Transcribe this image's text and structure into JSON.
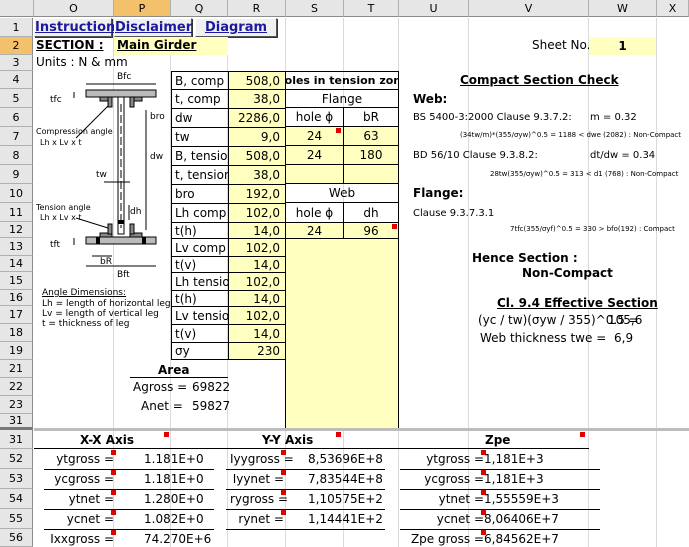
{
  "columns": [
    "O",
    "P",
    "Q",
    "R",
    "S",
    "T",
    "U",
    "V",
    "W",
    "X"
  ],
  "rows": [
    "1",
    "2",
    "3",
    "4",
    "5",
    "6",
    "7",
    "8",
    "9",
    "10",
    "11",
    "12",
    "13",
    "14",
    "15",
    "16",
    "17",
    "18",
    "19",
    "21",
    "22",
    "23",
    "31",
    "52",
    "53",
    "54",
    "55",
    "56"
  ],
  "buttons": {
    "instructions": "Instructions",
    "disclaimer": "Disclaimer",
    "diagram": "Diagram"
  },
  "header": {
    "section_label": "SECTION :",
    "section_value": "Main Girder",
    "units": "Units : N  & mm",
    "sheet_label": "Sheet No.",
    "sheet_value": "1"
  },
  "diagram_labels": {
    "bfc": "Bfc",
    "tfc": "tfc",
    "bro": "bro",
    "dw": "dw",
    "tw": "tw",
    "dh": "dh",
    "tfc2": "tft",
    "bR": "bR",
    "bft": "Bft",
    "comp_angle": "Compression angle",
    "comp_angle_dims": "Lh x Lv x t",
    "tens_angle": "Tension angle",
    "tens_angle_dims": "Lh x Lv x t",
    "angle_title": "Angle Dimensions:",
    "angle_lh": "Lh = length of horizontal leg",
    "angle_lv": "Lv = length of vertical leg",
    "angle_t": "t = thickness of leg"
  },
  "inputs": [
    {
      "label": "B, comp",
      "value": "508,0"
    },
    {
      "label": "t, comp",
      "value": "38,0"
    },
    {
      "label": "dw",
      "value": "2286,0"
    },
    {
      "label": "tw",
      "value": "9,0"
    },
    {
      "label": "B, tension",
      "value": "508,0"
    },
    {
      "label": "t, tension",
      "value": "38,0"
    },
    {
      "label": "bro",
      "value": "192,0"
    },
    {
      "label": "Lh comp",
      "value": "102,0"
    },
    {
      "label": "t(h)",
      "value": "14,0"
    },
    {
      "label": "Lv comp",
      "value": "102,0"
    },
    {
      "label": "t(v)",
      "value": "14,0"
    },
    {
      "label": "Lh tension",
      "value": "102,0"
    },
    {
      "label": "t(h)",
      "value": "14,0"
    },
    {
      "label": "Lv tension",
      "value": "102,0"
    },
    {
      "label": "t(v)",
      "value": "14,0"
    },
    {
      "label": "σy",
      "value": "230"
    }
  ],
  "holes": {
    "title": "Holes in tension zone",
    "flange": "Flange",
    "web": "Web",
    "hole_phi": "hole ϕ",
    "bR": "bR",
    "dh": "dh",
    "flange_rows": [
      [
        "24",
        "63"
      ],
      [
        "24",
        "180"
      ]
    ],
    "web_rows": [
      [
        "24",
        "96"
      ]
    ]
  },
  "check": {
    "title": "Compact Section Check",
    "web": "Web:",
    "bs": "BS 5400-3:2000 Clause 9.3.7.2:",
    "bs_m": "m = 0.32",
    "bs_formula": "(34tw/m)*(355/σyw)^0.5 = 1188 < dwe (2082) : Non-Compact",
    "bd": "BD 56/10 Clause 9.3.8.2:",
    "bd_ratio": "dt/dw = 0.34",
    "bd_formula": "28tw(355/σyw)^0.5 = 313 < d1 (768) : Non-Compact",
    "flange": "Flange:",
    "fl_clause": "Clause 9.3.7.3.1",
    "fl_formula": "7tfc(355/σyf)^0.5 = 330 > bfo(192) : Compact",
    "hence": "Hence Section :",
    "result": "Non-Compact",
    "eff_title": "Cl. 9.4 Effective Section",
    "eff1_label": "(yc / tw)(σyw / 355)^0.5 =",
    "eff1_value": "105,6",
    "eff2_label": "Web thickness twe =",
    "eff2_value": "6,9"
  },
  "area": {
    "title": "Area",
    "gross_label": "Agross =",
    "gross_value": "69822",
    "net_label": "Anet =",
    "net_value": "59827"
  },
  "xx": {
    "title": "X-X Axis",
    "rows": [
      [
        "ytgross =",
        "1.181E+0"
      ],
      [
        "ycgross =",
        "1.181E+0"
      ],
      [
        "ytnet =",
        "1.280E+0"
      ],
      [
        "ycnet =",
        "1.082E+0"
      ],
      [
        "Ixxgross =",
        "74.270E+6"
      ]
    ]
  },
  "yy": {
    "title": "Y-Y Axis",
    "rows": [
      [
        "Iyygross =",
        "8,53696E+8"
      ],
      [
        "Iyynet =",
        "7,83544E+8"
      ],
      [
        "rygross =",
        "1,10575E+2"
      ],
      [
        "rynet =",
        "1,14441E+2"
      ]
    ]
  },
  "zpe": {
    "title": "Zpe",
    "rows": [
      [
        "ytgross =",
        "1,181E+3"
      ],
      [
        "ycgross =",
        "1,181E+3"
      ],
      [
        "ytnet =",
        "1,55559E+3"
      ],
      [
        "ycnet =",
        "8,06406E+7"
      ],
      [
        "Zpe gross =",
        "6,84562E+7"
      ]
    ]
  }
}
